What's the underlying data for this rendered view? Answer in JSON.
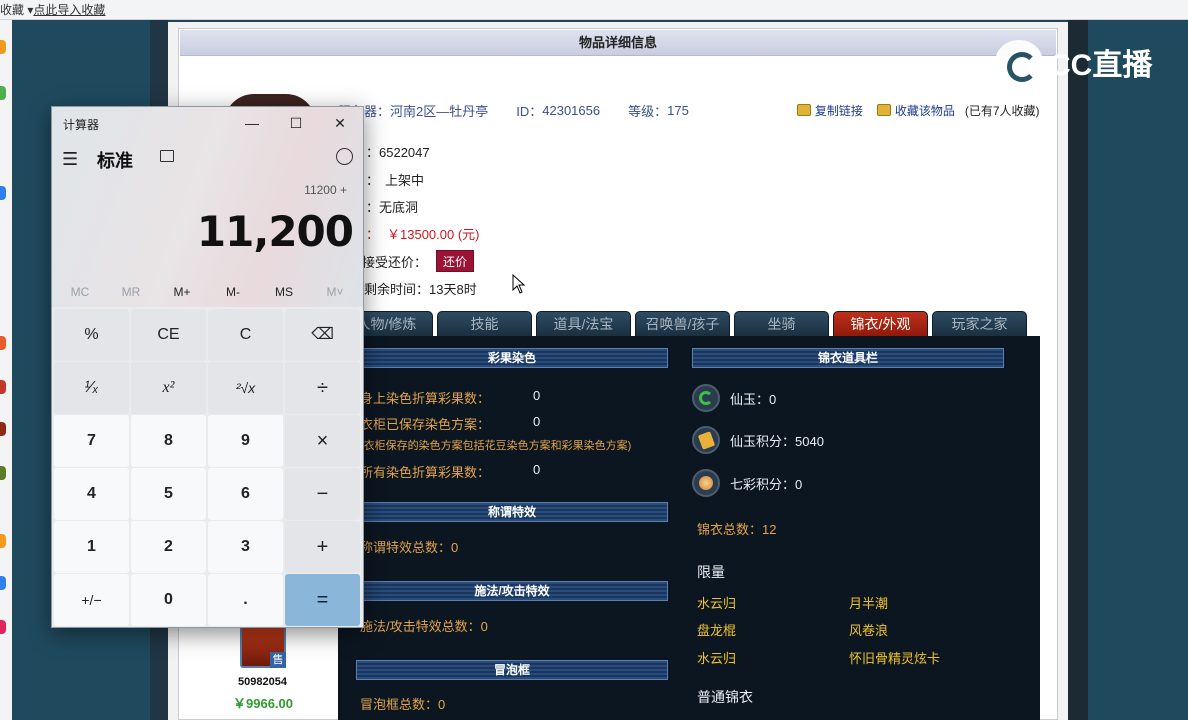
{
  "browser": {
    "bookmarks_label": "收藏",
    "bookmarks_arrow": "▾",
    "import_link": "点此导入收藏"
  },
  "panel": {
    "title": "物品详细信息",
    "server_label": "服务器：",
    "server_value": "河南2区—牡丹亭",
    "id_label": "ID：",
    "id_value": "42301656",
    "level_label": "等级：",
    "level_value": "175",
    "copy_link": "复制链接",
    "fav_link": "收藏该物品",
    "fav_count": "(已有7人收藏)",
    "details": [
      {
        "label": "：",
        "value": "6522047"
      },
      {
        "label": "：",
        "value": "上架中"
      },
      {
        "label": "：",
        "value": "无底洞"
      },
      {
        "label": "：",
        "value": "￥13500.00 (元)"
      }
    ],
    "accept_label": "接受还价：",
    "counter_button": "还价",
    "remain_label": "剩余时间：",
    "remain_value": "13天8时"
  },
  "tabs": [
    "人物/修炼",
    "技能",
    "道具/法宝",
    "召唤兽/孩子",
    "坐骑",
    "锦衣/外观",
    "玩家之家"
  ],
  "active_tab": 5,
  "content": {
    "dye_header": "彩果染色",
    "dye_rows": [
      {
        "label": "身上染色折算彩果数：",
        "value": "0"
      },
      {
        "label": "衣柜已保存染色方案：",
        "value": "0"
      },
      {
        "label": "(衣柜保存的染色方案包括花豆染色方案和彩果染色方案)",
        "value": ""
      },
      {
        "label": "所有染色折算彩果数：",
        "value": "0"
      }
    ],
    "title_effect_header": "称谓特效",
    "title_effect_total": "称谓特效总数：0",
    "spell_effect_header": "施法/攻击特效",
    "spell_effect_total": "施法/攻击特效总数：0",
    "bubble_header": "冒泡框",
    "bubble_total": "冒泡框总数：0",
    "wardrobe_header": "锦衣道具栏",
    "currencies": [
      {
        "icon": "jade-icon",
        "text": "仙玉：0"
      },
      {
        "icon": "jade-points-icon",
        "text": "仙玉积分：5040"
      },
      {
        "icon": "rainbow-points-icon",
        "text": "七彩积分：0"
      }
    ],
    "wardrobe_total": "锦衣总数：12",
    "limited_label": "限量",
    "limited_items": [
      "水云归",
      "月半潮",
      "盘龙棍",
      "风卷浪",
      "水云归",
      "怀旧骨精灵炫卡"
    ],
    "normal_label": "普通锦衣"
  },
  "seller": {
    "badge": "售",
    "id": "50982054",
    "price": "￥9966.00"
  },
  "logo": {
    "text": "CC直播"
  },
  "calculator": {
    "title": "计算器",
    "mode": "标准",
    "expression": "11200 +",
    "display": "11,200",
    "memory": [
      "MC",
      "MR",
      "M+",
      "M-",
      "MS",
      "M˅"
    ],
    "keys": [
      [
        "%",
        "CE",
        "C",
        "⌫"
      ],
      [
        "¹⁄ₓ",
        "x²",
        "²√x",
        "÷"
      ],
      [
        "7",
        "8",
        "9",
        "×"
      ],
      [
        "4",
        "5",
        "6",
        "−"
      ],
      [
        "1",
        "2",
        "3",
        "+"
      ],
      [
        "+/−",
        "0",
        ".",
        "="
      ]
    ]
  },
  "colors": {
    "accent_red": "#9b1436",
    "price_red": "#d2171d",
    "gold": "#f0c42a",
    "equals_blue": "#8ab6d9"
  }
}
